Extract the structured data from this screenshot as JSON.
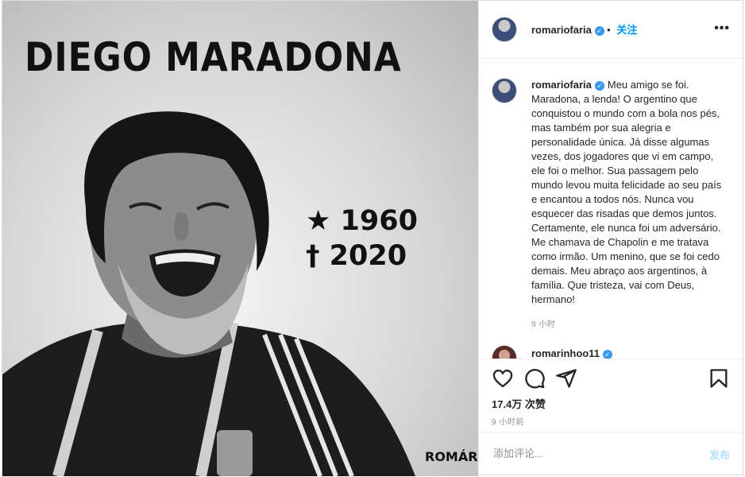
{
  "photo": {
    "title": "DIEGO MARADONA",
    "birth": "★ 1960",
    "death": "† 2020",
    "logo": "ROMÁRIO"
  },
  "header": {
    "username": "romariofaria",
    "separator": "•",
    "follow_label": "关注",
    "more_icon": "more-horizontal-icon"
  },
  "caption": {
    "username": "romariofaria",
    "text": "Meu amigo se foi. Maradona, a lenda! O argentino que conquistou o mundo com a bola nos pés, mas também por sua alegria e personalidade única. Já disse algumas vezes, dos jogadores que vi em campo, ele foi o melhor. Sua passagem pelo mundo levou muita felicidade ao seu país e encantou a todos nós. Nunca vou esquecer das risadas que demos juntos. Certamente, ele nunca foi um adversário. Me chamava de Chapolin e me tratava como irmão. Um menino, que se foi cedo demais. Meu abraço aos argentinos, à família. Que tristeza, vai com Deus, hermano!",
    "time": "9 小时"
  },
  "next_comment": {
    "username": "romarinhoo11"
  },
  "actions": {
    "likes": "17.4万 次赞",
    "time": "9 小时前"
  },
  "comment_box": {
    "placeholder": "添加评论...",
    "post_label": "发布"
  },
  "colors": {
    "accent": "#0095f6",
    "post_disabled": "#b2dffc",
    "border": "#dbdbdb",
    "muted": "#8e8e8e"
  }
}
